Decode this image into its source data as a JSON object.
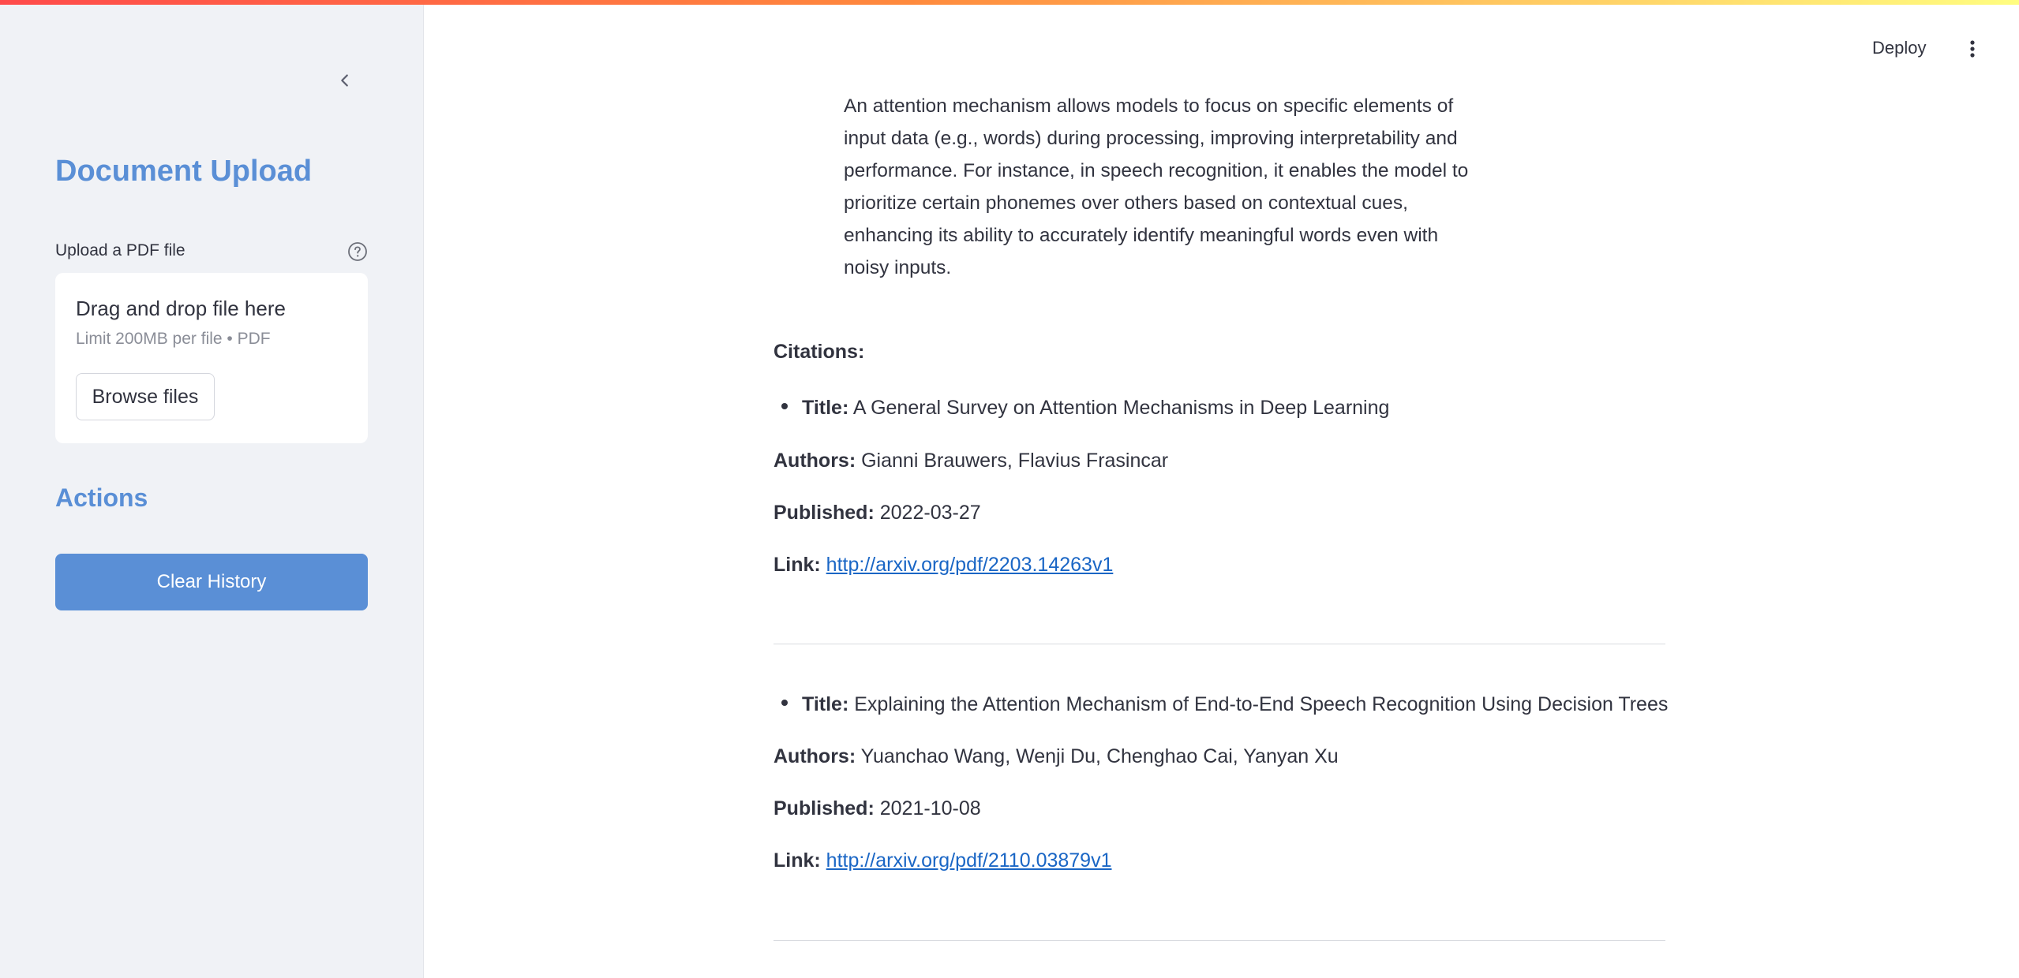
{
  "header": {
    "deploy_label": "Deploy"
  },
  "sidebar": {
    "document_heading": "Document Upload",
    "upload_label": "Upload a PDF file",
    "dropzone": {
      "title": "Drag and drop file here",
      "limit": "Limit 200MB per file • PDF",
      "browse_label": "Browse files"
    },
    "actions_heading": "Actions",
    "clear_history_label": "Clear History"
  },
  "main": {
    "answer_text": "An attention mechanism allows models to focus on specific elements of input data (e.g., words) during processing, improving interpretability and performance. For instance, in speech recognition, it enables the model to prioritize certain phonemes over others based on contextual cues, enhancing its ability to accurately identify meaningful words even with noisy inputs.",
    "citations_label": "Citations:",
    "labels": {
      "title": "Title:",
      "authors": "Authors:",
      "published": "Published:",
      "link": "Link:"
    },
    "citations": [
      {
        "title": "A General Survey on Attention Mechanisms in Deep Learning",
        "authors": "Gianni Brauwers, Flavius Frasincar",
        "published": "2022-03-27",
        "link": "http://arxiv.org/pdf/2203.14263v1"
      },
      {
        "title": "Explaining the Attention Mechanism of End-to-End Speech Recognition Using Decision Trees",
        "authors": "Yuanchao Wang, Wenji Du, Chenghao Cai, Yanyan Xu",
        "published": "2021-10-08",
        "link": "http://arxiv.org/pdf/2110.03879v1"
      }
    ]
  },
  "colors": {
    "accent": "#5a8fd6",
    "link": "#1a66c5",
    "sidebar_bg": "#f0f2f6"
  },
  "icons": [
    "chevron-left-icon",
    "help-circle-icon",
    "vertical-dots-icon"
  ]
}
